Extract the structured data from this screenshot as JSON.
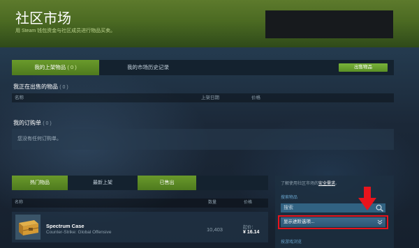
{
  "header": {
    "title": "社区市场",
    "subtitle": "用 Steam 钱包资金与社区成员进行物品买卖。"
  },
  "tabs": {
    "my_listings": "我的上架物品",
    "my_listings_count": "( 0 )",
    "history": "我的市场历史记录",
    "sell_button": "出售物品"
  },
  "selling": {
    "title": "我正在出售的物品",
    "count": "( 0 )",
    "columns": [
      "名称",
      "上架日期",
      "价格"
    ]
  },
  "orders": {
    "title": "我的订购单",
    "count": "( 0 )",
    "empty": "您没有任何订购单。"
  },
  "browse_tabs": [
    "热门物品",
    "最新上架",
    "已售出"
  ],
  "list": {
    "columns": [
      "名称",
      "数量",
      "价格"
    ],
    "items": [
      {
        "name": "Spectrum Case",
        "game": "Counter-Strike: Global Offensive",
        "quantity": "10,403",
        "price_label": "起价：",
        "price": "¥ 16.14"
      }
    ]
  },
  "sidebar": {
    "info_prefix": "了解使用社区市场的",
    "info_link": "安全需求",
    "info_suffix": "。",
    "search_label": "搜索物品",
    "search_placeholder": "搜索",
    "advanced_options": "显示进阶选项...",
    "browse_by_game": "按游戏浏览"
  },
  "colors": {
    "accent_green": "#6a9a2b",
    "highlight_red": "#e8141c",
    "background": "#1b2838"
  }
}
